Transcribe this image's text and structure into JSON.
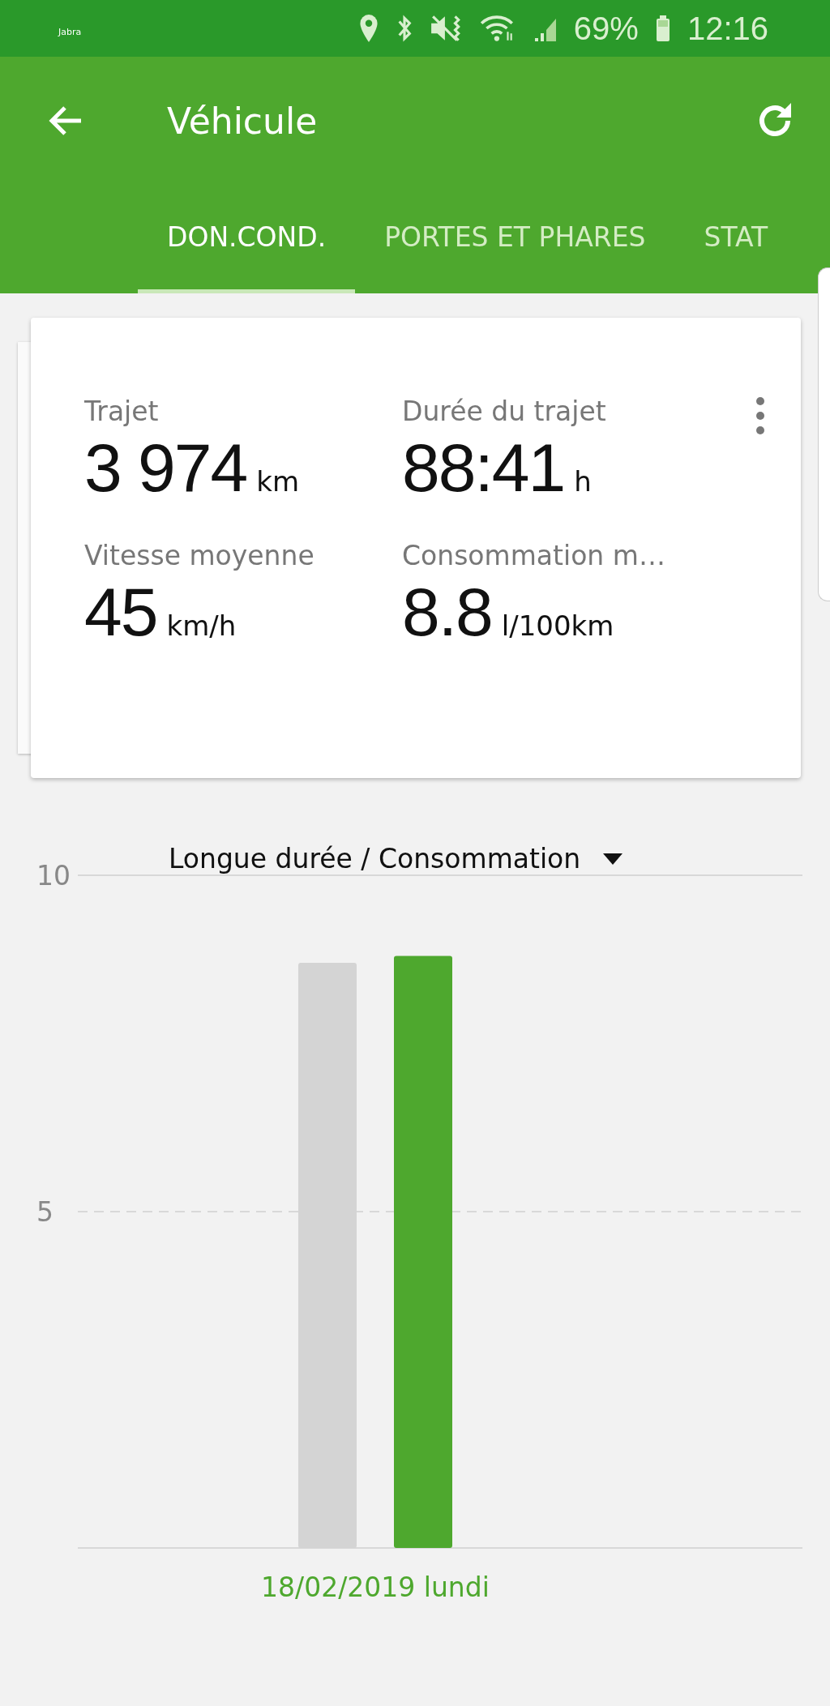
{
  "status_bar": {
    "app_label": "Jabra",
    "battery": "69%",
    "time": "12:16"
  },
  "app_bar": {
    "title": "Véhicule"
  },
  "tabs": [
    {
      "label": "DON.COND.",
      "selected": true
    },
    {
      "label": "PORTES ET PHARES",
      "selected": false
    },
    {
      "label": "STAT",
      "selected": false
    }
  ],
  "stats": [
    {
      "label": "Trajet",
      "value": "3 974",
      "unit": "km"
    },
    {
      "label": "Durée du trajet",
      "value": "88:41",
      "unit": "h"
    },
    {
      "label": "Vitesse moyenne",
      "value": "45",
      "unit": "km/h"
    },
    {
      "label": "Consommation m…",
      "value": "8.8",
      "unit": "l/100km"
    }
  ],
  "chart": {
    "selector": "Longue durée / Consommation",
    "chart_data": {
      "type": "bar",
      "categories": [
        "18/02/2019 lundi"
      ],
      "series": [
        {
          "color": "#d4d4d4",
          "values": [
            8.7
          ]
        },
        {
          "color": "#4ea82e",
          "values": [
            8.8
          ]
        }
      ],
      "ylim": [
        0,
        10
      ],
      "yticks": [
        5,
        10
      ]
    }
  }
}
